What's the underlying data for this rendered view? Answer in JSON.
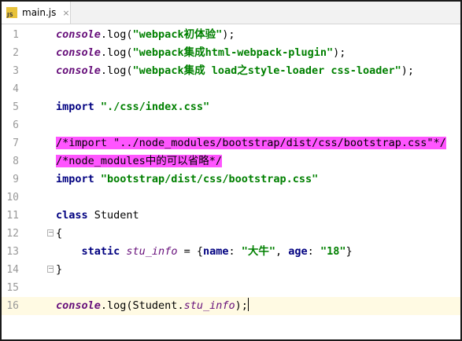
{
  "tab": {
    "filename": "main.js",
    "icon_text": "JS",
    "close_glyph": "×"
  },
  "colors": {
    "keyword": "#000080",
    "string": "#008000",
    "global_object": "#660e7a",
    "comment_highlight": "#ff55ff",
    "current_line": "#fffae3",
    "line_number": "#999999"
  },
  "lines": [
    {
      "num": "1",
      "parts": [
        {
          "t": "console",
          "c": "obj"
        },
        {
          "t": ".log(",
          "c": ""
        },
        {
          "t": "\"webpack初体验\"",
          "c": "str"
        },
        {
          "t": ");",
          "c": ""
        }
      ]
    },
    {
      "num": "2",
      "parts": [
        {
          "t": "console",
          "c": "obj"
        },
        {
          "t": ".log(",
          "c": ""
        },
        {
          "t": "\"webpack集成html-webpack-plugin\"",
          "c": "str"
        },
        {
          "t": ");",
          "c": ""
        }
      ]
    },
    {
      "num": "3",
      "parts": [
        {
          "t": "console",
          "c": "obj"
        },
        {
          "t": ".log(",
          "c": ""
        },
        {
          "t": "\"webpack集成 load之style-loader css-loader\"",
          "c": "str"
        },
        {
          "t": ");",
          "c": ""
        }
      ]
    },
    {
      "num": "4",
      "parts": []
    },
    {
      "num": "5",
      "parts": [
        {
          "t": "import ",
          "c": "kw"
        },
        {
          "t": "\"./css/index.css\"",
          "c": "str"
        }
      ]
    },
    {
      "num": "6",
      "parts": []
    },
    {
      "num": "7",
      "parts": [
        {
          "t": "/*import \"../node_modules/bootstrap/dist/css/bootstrap.css\"*/",
          "c": "cmt"
        }
      ]
    },
    {
      "num": "8",
      "parts": [
        {
          "t": "/*node_modules中的可以省略*/",
          "c": "cmt"
        }
      ]
    },
    {
      "num": "9",
      "parts": [
        {
          "t": "import ",
          "c": "kw"
        },
        {
          "t": "\"bootstrap/dist/css/bootstrap.css\"",
          "c": "str"
        }
      ]
    },
    {
      "num": "10",
      "parts": []
    },
    {
      "num": "11",
      "parts": [
        {
          "t": "class ",
          "c": "kw"
        },
        {
          "t": "Student",
          "c": ""
        }
      ]
    },
    {
      "num": "12",
      "fold": true,
      "parts": [
        {
          "t": "{",
          "c": ""
        }
      ]
    },
    {
      "num": "13",
      "parts": [
        {
          "t": "    ",
          "c": ""
        },
        {
          "t": "static ",
          "c": "kw"
        },
        {
          "t": "stu_info",
          "c": "prop"
        },
        {
          "t": " = {",
          "c": ""
        },
        {
          "t": "name",
          "c": "key"
        },
        {
          "t": ": ",
          "c": ""
        },
        {
          "t": "\"大牛\"",
          "c": "str"
        },
        {
          "t": ", ",
          "c": ""
        },
        {
          "t": "age",
          "c": "key"
        },
        {
          "t": ": ",
          "c": ""
        },
        {
          "t": "\"18\"",
          "c": "str"
        },
        {
          "t": "}",
          "c": ""
        }
      ]
    },
    {
      "num": "14",
      "fold": true,
      "parts": [
        {
          "t": "}",
          "c": ""
        }
      ]
    },
    {
      "num": "15",
      "parts": []
    },
    {
      "num": "16",
      "current": true,
      "parts": [
        {
          "t": "console",
          "c": "obj"
        },
        {
          "t": ".log(Student.",
          "c": ""
        },
        {
          "t": "stu_info",
          "c": "prop"
        },
        {
          "t": ");",
          "c": ""
        }
      ]
    }
  ]
}
